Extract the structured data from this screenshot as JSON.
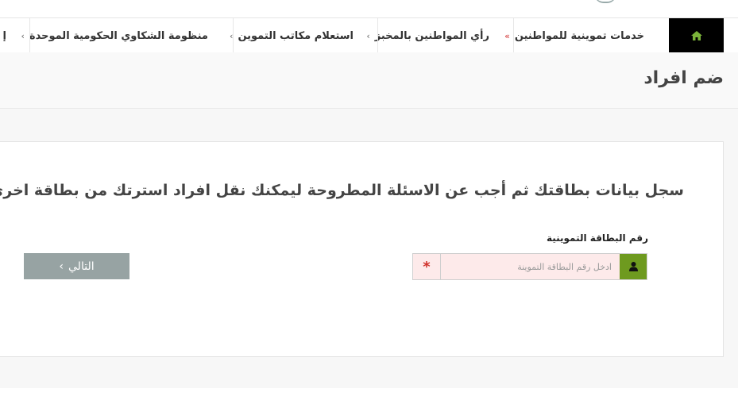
{
  "nav": {
    "items": [
      {
        "label": "خدمات تموينية للمواطنين",
        "arrow": "»"
      },
      {
        "label": "رأي المواطنين بالمخبز",
        "arrow": "›"
      },
      {
        "label": "استعلام مكاتب التموين",
        "arrow": "›"
      },
      {
        "label": "منظومة الشكاوي الحكومية الموحدة",
        "arrow": "›"
      },
      {
        "label": "إ"
      }
    ],
    "home_icon": "home-icon"
  },
  "page": {
    "title": "ضم افراد"
  },
  "form": {
    "instruction": "سجل بيانات بطاقتك ثم أجب عن الاسئلة المطروحة ليمكنك نقل افراد استرتك من بطاقة اخرى",
    "card_label": "رقم البطاقة التموينية",
    "card_placeholder": "ادخل رقم البطاقة التموينة",
    "required_mark": "*",
    "next_label": "التالي",
    "next_arrow": "›"
  },
  "colors": {
    "accent_green": "#6e9a1f",
    "button_gray": "#97a3a3",
    "required_red": "#d0302a"
  }
}
